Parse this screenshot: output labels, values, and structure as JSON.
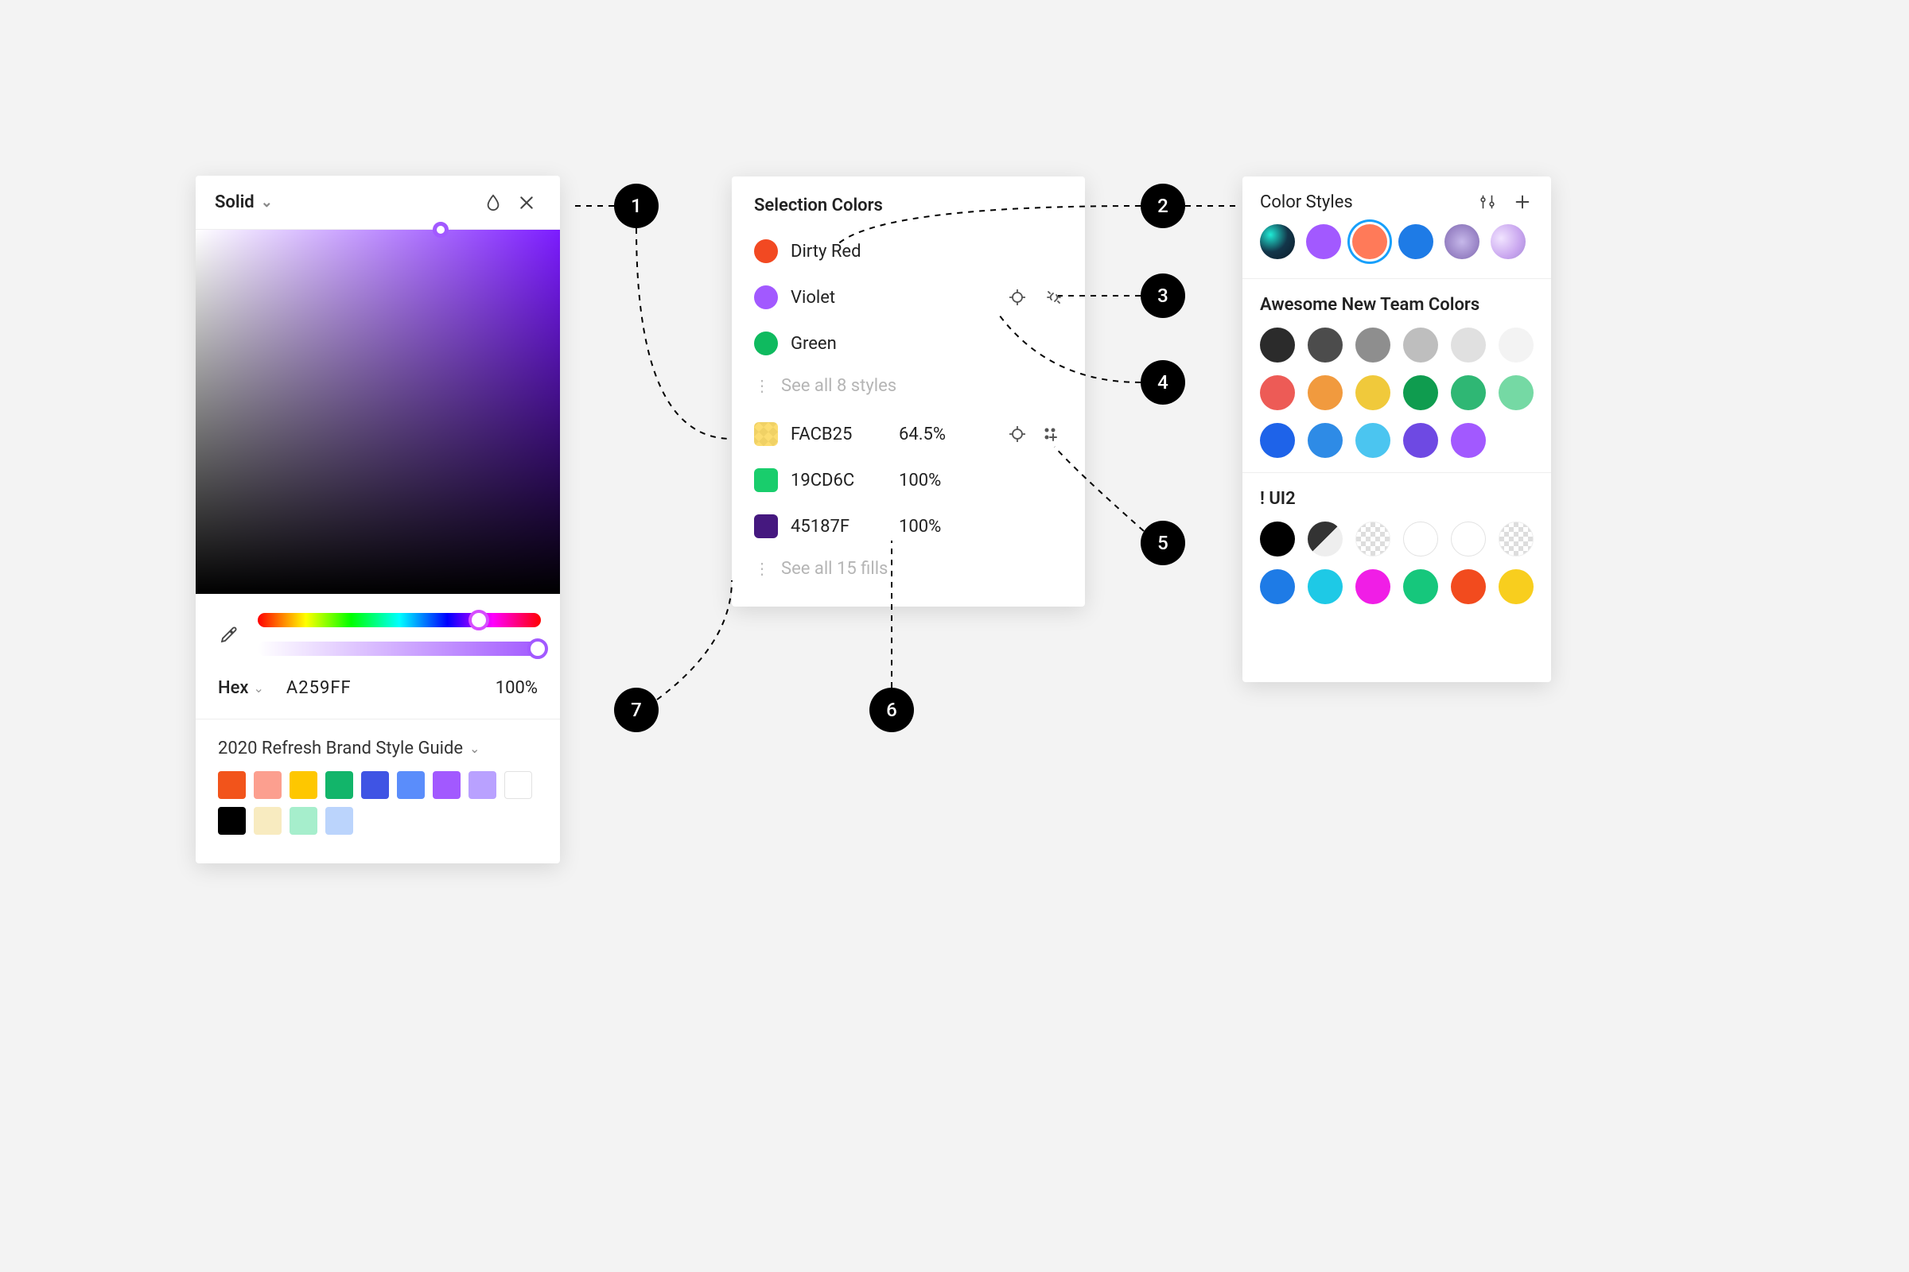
{
  "colorPicker": {
    "mode": "Solid",
    "hexLabel": "Hex",
    "hexValue": "A259FF",
    "opacity": "100%",
    "library": {
      "title": "2020 Refresh Brand Style Guide",
      "swatches": [
        "#F2541B",
        "#FC9F8F",
        "#FEC700",
        "#12B56A",
        "#3F54E4",
        "#5A8DFB",
        "#A259FF",
        "#B9A1FF",
        "#FFFFFF",
        "#000000",
        "#F8EBC0",
        "#A6EECC",
        "#BBD4FC"
      ]
    }
  },
  "selectionColors": {
    "title": "Selection Colors",
    "styles": [
      {
        "name": "Dirty Red",
        "color": "#F24922"
      },
      {
        "name": "Violet",
        "color": "#A259FF"
      },
      {
        "name": "Green",
        "color": "#0FBA5F"
      }
    ],
    "seeAllStyles": "See all 8 styles",
    "fills": [
      {
        "hex": "FACB25",
        "opacity": "64.5%",
        "color": "#FACB25",
        "checkered": true
      },
      {
        "hex": "19CD6C",
        "opacity": "100%",
        "color": "#19CD6C"
      },
      {
        "hex": "45187F",
        "opacity": "100%",
        "color": "#45187F"
      }
    ],
    "seeAllFills": "See all 15 fills"
  },
  "colorStyles": {
    "title": "Color Styles",
    "groups": [
      {
        "title": "Awesome New Team Colors",
        "swatches": [
          "#2B2B2B",
          "#4C4C4C",
          "#8E8E8E",
          "#BEBEBE",
          "#E0E0E0",
          "#F3F3F3",
          "#ED5B56",
          "#F19A3E",
          "#F0C93B",
          "#0F9C4F",
          "#2FB774",
          "#75D9A4",
          "#1E63E9",
          "#2E8BE6",
          "#4BC5F0",
          "#6E49E3",
          "#A259FF"
        ]
      },
      {
        "title": "! UI2",
        "swatches": [
          "#000000",
          "halfgrey",
          "check",
          "outline",
          "outline",
          "check",
          "#1E7BE6",
          "#1EC9E6",
          "#F01EE6",
          "#16C77C",
          "#F24B1E",
          "#F8CE1E"
        ]
      }
    ],
    "topRow": [
      "noise1",
      "#A259FF",
      "selected",
      "#1E7BE6",
      "noise2",
      "noise3"
    ],
    "selectedTopColor": "#FF7A59"
  },
  "callouts": [
    "1",
    "2",
    "3",
    "4",
    "5",
    "6",
    "7"
  ]
}
